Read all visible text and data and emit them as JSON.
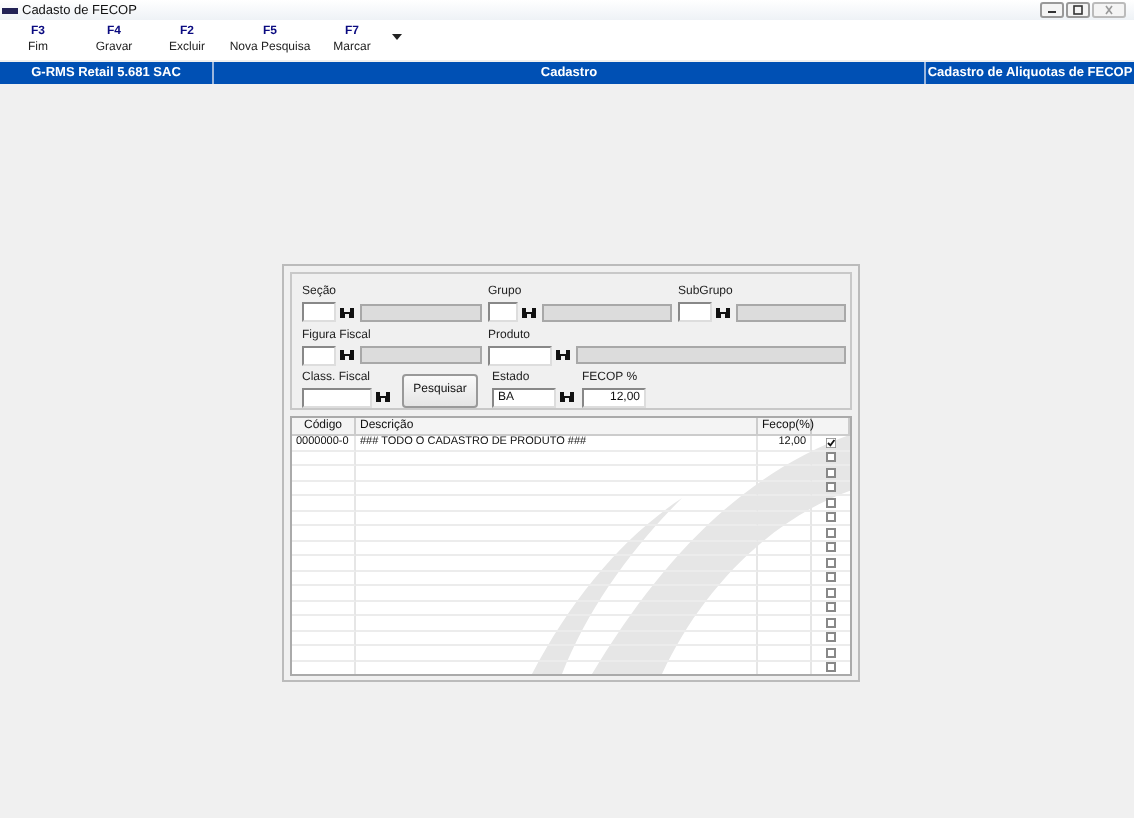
{
  "window": {
    "title": "Cadasto de FECOP"
  },
  "toolbar": [
    {
      "key": "F3",
      "label": "Fim"
    },
    {
      "key": "F4",
      "label": "Gravar"
    },
    {
      "key": "F2",
      "label": "Excluir"
    },
    {
      "key": "F5",
      "label": "Nova Pesquisa"
    },
    {
      "key": "F7",
      "label": "Marcar"
    }
  ],
  "header_bar": [
    "G-RMS Retail 5.681 SAC",
    "Cadastro",
    "Cadastro de Aliquotas de FECOP"
  ],
  "filters": [
    {
      "label": "Seção",
      "kind": "lookup"
    },
    {
      "label": "Grupo",
      "kind": "lookup"
    },
    {
      "label": "SubGrupo",
      "kind": "lookup"
    },
    {
      "label": "Figura Fiscal",
      "kind": "lookup"
    },
    {
      "label": "Produto",
      "kind": "lookup"
    },
    {
      "label": "Class. Fiscal",
      "kind": "code"
    },
    {
      "label": "Estado",
      "kind": "code",
      "value": "BA"
    },
    {
      "label": "FECOP %",
      "kind": "number",
      "value": "12,00"
    }
  ],
  "search_button": "Pesquisar",
  "table": {
    "columns": [
      "Código",
      "Descrição",
      "Fecop(%)"
    ],
    "rows": [
      {
        "codigo": "0000000-0",
        "descricao": "### TODO O CADASTRO DE PRODUTO ###",
        "fecop": "12,00",
        "checked": true
      },
      {
        "checked": false
      },
      {
        "checked": false
      },
      {
        "checked": false
      },
      {
        "checked": false
      },
      {
        "checked": false
      },
      {
        "checked": false
      },
      {
        "checked": false
      },
      {
        "checked": false
      },
      {
        "checked": false
      },
      {
        "checked": false
      },
      {
        "checked": false
      },
      {
        "checked": false
      },
      {
        "checked": false
      },
      {
        "checked": false
      },
      {
        "checked": false
      }
    ]
  }
}
